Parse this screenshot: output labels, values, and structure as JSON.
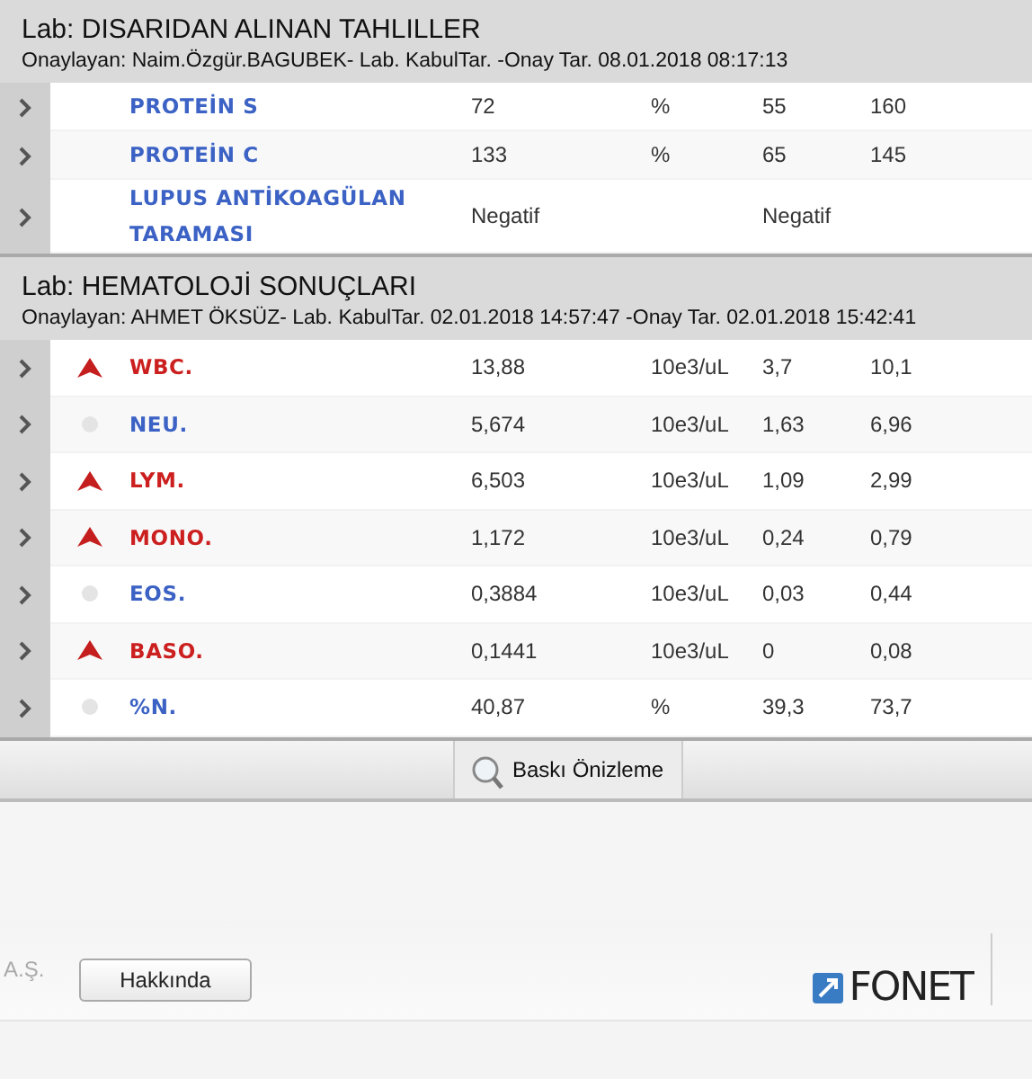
{
  "sections": [
    {
      "title": "Lab: DISARIDAN ALINAN TAHLILLER",
      "approval": "Onaylayan: Naim.Özgür.BAGUBEK- Lab. KabulTar. -Onay Tar. 08.01.2018 08:17:13",
      "rows": [
        {
          "name": "PROTEİN S",
          "value": "72",
          "unit": "%",
          "low": "55",
          "high": "160"
        },
        {
          "name": "PROTEİN C",
          "value": "133",
          "unit": "%",
          "low": "65",
          "high": "145"
        },
        {
          "name": "LUPUS ANTİKOAGÜLAN TARAMASI",
          "value": "Negatif",
          "low": "Negatif"
        }
      ]
    },
    {
      "title": "Lab: HEMATOLOJİ SONUÇLARI",
      "approval": "Onaylayan: AHMET ÖKSÜZ- Lab. KabulTar. 02.01.2018 14:57:47 -Onay Tar. 02.01.2018 15:42:41",
      "rows": [
        {
          "out_of_range": true,
          "name": "WBC.",
          "value": "13,88",
          "unit": "10e3/uL",
          "low": "3,7",
          "high": "10,1"
        },
        {
          "out_of_range": false,
          "name": "NEU.",
          "value": "5,674",
          "unit": "10e3/uL",
          "low": "1,63",
          "high": "6,96"
        },
        {
          "out_of_range": true,
          "name": "LYM.",
          "value": "6,503",
          "unit": "10e3/uL",
          "low": "1,09",
          "high": "2,99"
        },
        {
          "out_of_range": true,
          "name": "MONO.",
          "value": "1,172",
          "unit": "10e3/uL",
          "low": "0,24",
          "high": "0,79"
        },
        {
          "out_of_range": false,
          "name": "EOS.",
          "value": "0,3884",
          "unit": "10e3/uL",
          "low": "0,03",
          "high": "0,44"
        },
        {
          "out_of_range": true,
          "name": "BASO.",
          "value": "0,1441",
          "unit": "10e3/uL",
          "low": "0",
          "high": "0,08"
        },
        {
          "out_of_range": false,
          "name": "%N.",
          "value": "40,87",
          "unit": "%",
          "low": "39,3",
          "high": "73,7"
        }
      ]
    }
  ],
  "toolbar": {
    "print_preview": "Baskı Önizleme"
  },
  "footer": {
    "company_suffix": "A.Ş.",
    "about": "Hakkında",
    "logo": "FONET"
  }
}
